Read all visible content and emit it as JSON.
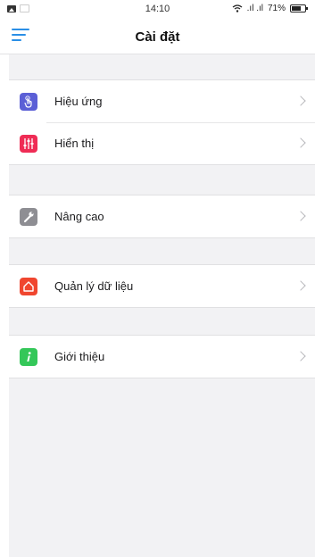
{
  "status_bar": {
    "time": "14:10",
    "signal_text": ".ıl .ıl",
    "battery_percent": "71%",
    "icons": [
      "image-icon",
      "message-icon",
      "wifi-icon",
      "signal-icon",
      "battery-icon"
    ]
  },
  "header": {
    "title": "Cài đặt",
    "menu_icon": "menu-icon",
    "accent_color": "#2b8fe6"
  },
  "groups": [
    {
      "items": [
        {
          "label": "Hiệu ứng",
          "icon": "touch-icon",
          "color": "#5b5fd6"
        },
        {
          "label": "Hiển thị",
          "icon": "sliders-icon",
          "color": "#ef2c55"
        }
      ]
    },
    {
      "items": [
        {
          "label": "Nâng cao",
          "icon": "wrench-icon",
          "color": "#8e8e93"
        }
      ]
    },
    {
      "items": [
        {
          "label": "Quản lý dữ liệu",
          "icon": "house-icon",
          "color": "#f0462f"
        }
      ]
    },
    {
      "items": [
        {
          "label": "Giới thiệu",
          "icon": "info-icon",
          "color": "#34c759"
        }
      ]
    }
  ]
}
